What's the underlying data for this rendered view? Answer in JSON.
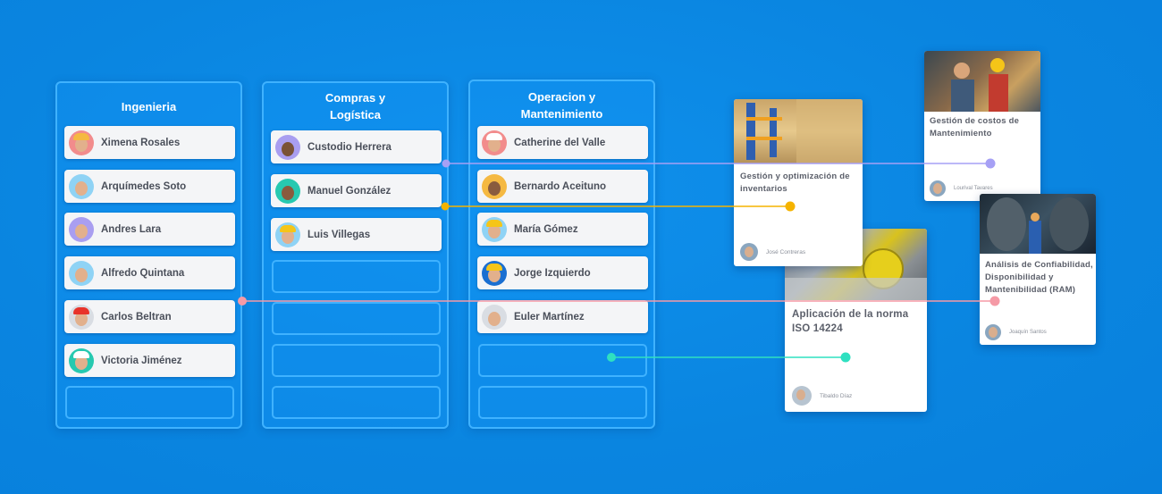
{
  "columns": [
    {
      "title": "Ingenieria",
      "people": [
        {
          "name": "Ximena Rosales",
          "avatar_bg": "#f28c8c",
          "hat": "#f5b942"
        },
        {
          "name": "Arquímedes Soto",
          "avatar_bg": "#8fd3f5",
          "hat": ""
        },
        {
          "name": "Andres Lara",
          "avatar_bg": "#a99ef0",
          "hat": ""
        },
        {
          "name": "Alfredo Quintana",
          "avatar_bg": "#8fd3f5",
          "hat": ""
        },
        {
          "name": "Carlos Beltran",
          "avatar_bg": "#d9dde3",
          "hat": "#e8332a"
        },
        {
          "name": "Victoria Jiménez",
          "avatar_bg": "#27c9b0",
          "hat": "#ffffff"
        }
      ]
    },
    {
      "title_line1": "Compras y",
      "title_line2": "Logística",
      "people": [
        {
          "name": "Custodio Herrera",
          "avatar_bg": "#a99ef0",
          "hat": ""
        },
        {
          "name": "Manuel González",
          "avatar_bg": "#27c9b0",
          "hat": ""
        },
        {
          "name": "Luis Villegas",
          "avatar_bg": "#8fd3f5",
          "hat": "#f5c518"
        }
      ]
    },
    {
      "title_line1": "Operacion y",
      "title_line2": "Mantenimiento",
      "people": [
        {
          "name": "Catherine del Valle",
          "avatar_bg": "#f28c8c",
          "hat": "#ffffff"
        },
        {
          "name": "Bernardo Aceituno",
          "avatar_bg": "#f5b942",
          "hat": ""
        },
        {
          "name": "María Gómez",
          "avatar_bg": "#8fd3f5",
          "hat": "#f5c518"
        },
        {
          "name": "Jorge Izquierdo",
          "avatar_bg": "#1a6fd1",
          "hat": "#f5c518"
        },
        {
          "name": "Euler Martínez",
          "avatar_bg": "#d9dde3",
          "hat": ""
        }
      ]
    }
  ],
  "courses": [
    {
      "title": "Gestión de costos de Mantenimiento",
      "author": "Lourival Tavares"
    },
    {
      "title": "Gestión y optimización de inventarios",
      "author": "José Contreras"
    },
    {
      "title": "Análisis de Confiabilidad, Disponibilidad y Mantenibilidad (RAM)",
      "author": "Joaquín Santos"
    },
    {
      "title": "Aplicación de la norma ISO 14224",
      "author": "Tibaldo Díaz"
    }
  ],
  "colors": {
    "background": "#0a85e0",
    "column_border": "#3fb2ff",
    "connector_purple": "#a6a0f5",
    "connector_yellow": "#f5b300",
    "connector_pink": "#f59aa6",
    "connector_teal": "#2fe0c0"
  }
}
